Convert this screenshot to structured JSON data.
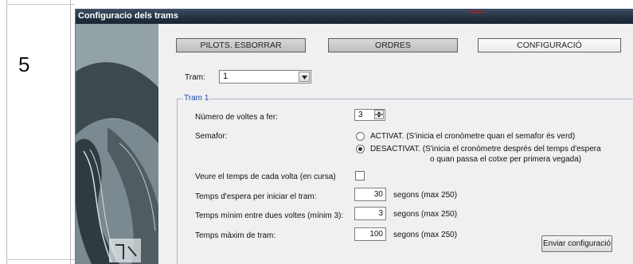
{
  "step": {
    "number": "5"
  },
  "window": {
    "title": "Configuracio dels trams"
  },
  "tabs": [
    {
      "label": "PILOTS. ESBORRAR"
    },
    {
      "label": "ORDRES"
    },
    {
      "label": "CONFIGURACIÓ",
      "active": true
    }
  ],
  "tram_select": {
    "label": "Tram:",
    "value": "1"
  },
  "group": {
    "title": "Tram 1",
    "laps": {
      "label": "Número de voltes a fer:",
      "value": "3"
    },
    "semaphore": {
      "label": "Semafor:",
      "options": [
        {
          "line1": "ACTIVAT. (S'inicia el cronòmetre quan el semafor és verd)",
          "line2": "",
          "checked": false
        },
        {
          "line1": "DESACTIVAT. (S'inicia el cronòmetre després del temps d'espera",
          "line2": "o quan passa el cotxe per primera vegada)",
          "checked": true
        }
      ]
    },
    "show_lap_time": {
      "label": "Veure el temps de cada volta (en cursa)",
      "checked": false
    },
    "wait_time": {
      "label": "Temps d'espera per iniciar el tram:",
      "value": "30",
      "unit": "segons (max 250)"
    },
    "min_time": {
      "label": "Temps mínim entre dues voltes (mínim 3):",
      "value": "3",
      "unit": "segons (max 250)"
    },
    "max_time": {
      "label": "Temps màxim de tram:",
      "value": "100",
      "unit": "segons (max 250)"
    },
    "send_button": {
      "label": "Enviar configuració"
    }
  },
  "icons": {
    "dropdown": "chevron-down-icon",
    "spin_up": "caret-up-icon",
    "spin_down": "caret-down-icon"
  },
  "colors": {
    "titlebar": "#22303f",
    "group_title": "#1f4ea8"
  }
}
